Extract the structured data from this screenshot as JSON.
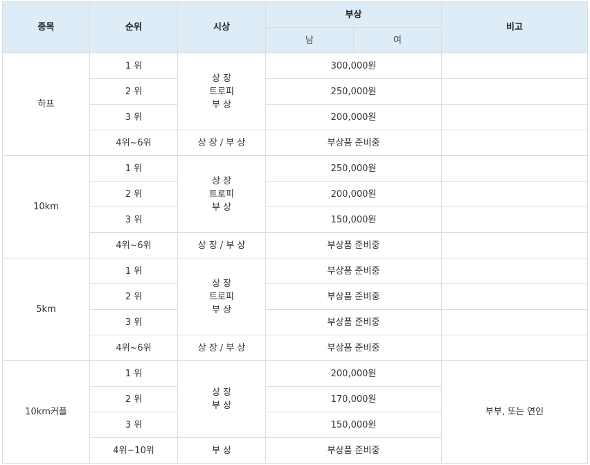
{
  "table": {
    "headers": {
      "event": "종목",
      "rank": "순위",
      "award": "시상",
      "prize": "부상",
      "male": "남",
      "female": "여",
      "note": "비고"
    },
    "groups": [
      {
        "event": "하프",
        "ranks": [
          "1 위",
          "2 위",
          "3 위",
          "4위~6위"
        ],
        "award_top": "상 장\n트로피\n부 상",
        "award_bottom": "상 장 / 부 상",
        "prizes": [
          "300,000원",
          "250,000원",
          "200,000원",
          "부상품 준비중"
        ],
        "note": ""
      },
      {
        "event": "10km",
        "ranks": [
          "1 위",
          "2 위",
          "3 위",
          "4위~6위"
        ],
        "award_top": "상 장\n트로피\n부 상",
        "award_bottom": "상 장 / 부 상",
        "prizes": [
          "250,000원",
          "200,000원",
          "150,000원",
          "부상품 준비중"
        ],
        "note": ""
      },
      {
        "event": "5km",
        "ranks": [
          "1 위",
          "2 위",
          "3 위",
          "4위~6위"
        ],
        "award_top": "상 장\n트로피\n부 상",
        "award_bottom": "상 장 / 부 상",
        "prizes": [
          "부상품 준비중",
          "부상품 준비중",
          "부상품 준비중",
          "부상품 준비중"
        ],
        "note": ""
      },
      {
        "event": "10km커플",
        "ranks": [
          "1 위",
          "2 위",
          "3 위",
          "4위~10위"
        ],
        "award_top": "상 장\n부 상",
        "award_bottom": "부 상",
        "prizes": [
          "200,000원",
          "170,000원",
          "150,000원",
          "부상품 준비중"
        ],
        "note": "부부, 또는 연인"
      }
    ]
  }
}
